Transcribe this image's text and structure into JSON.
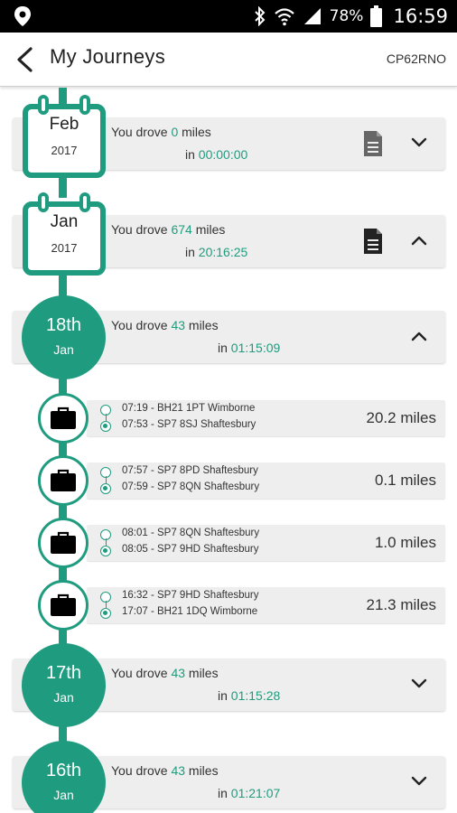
{
  "status": {
    "battery": "78%",
    "time": "16:59"
  },
  "header": {
    "title": "My Journeys",
    "vehicle": "CP62RNO"
  },
  "months": [
    {
      "month": "Feb",
      "year": "2017",
      "prefix": "You drove",
      "miles": "0",
      "suffix": "miles",
      "in": "in",
      "duration": "00:00:00"
    },
    {
      "month": "Jan",
      "year": "2017",
      "prefix": "You drove",
      "miles": "674",
      "suffix": "miles",
      "in": "in",
      "duration": "20:16:25"
    }
  ],
  "days": [
    {
      "day": "18th",
      "month": "Jan",
      "prefix": "You drove",
      "miles": "43",
      "suffix": "miles",
      "in": "in",
      "duration": "01:15:09"
    },
    {
      "day": "17th",
      "month": "Jan",
      "prefix": "You drove",
      "miles": "43",
      "suffix": "miles",
      "in": "in",
      "duration": "01:15:28"
    },
    {
      "day": "16th",
      "month": "Jan",
      "prefix": "You drove",
      "miles": "43",
      "suffix": "miles",
      "in": "in",
      "duration": "01:21:07"
    }
  ],
  "trips": [
    {
      "start": "07:19 - BH21 1PT Wimborne",
      "end": "07:53 - SP7 8SJ Shaftesbury",
      "distance": "20.2 miles"
    },
    {
      "start": "07:57 - SP7 8PD Shaftesbury",
      "end": "07:59 - SP7 8QN Shaftesbury",
      "distance": "0.1 miles"
    },
    {
      "start": "08:01 - SP7 8QN Shaftesbury",
      "end": "08:05 - SP7 9HD Shaftesbury",
      "distance": "1.0 miles"
    },
    {
      "start": "16:32 - SP7 9HD Shaftesbury",
      "end": "17:07 - BH21 1DQ Wimborne",
      "distance": "21.3 miles"
    }
  ],
  "colors": {
    "accent": "#1f9c7f",
    "card": "#eeeeee"
  },
  "icons": [
    "location-icon",
    "bluetooth-icon",
    "wifi-icon",
    "signal-icon",
    "battery-icon",
    "back-arrow-icon",
    "document-icon",
    "chevron-up-icon",
    "chevron-down-icon",
    "briefcase-icon",
    "calendar-icon"
  ]
}
